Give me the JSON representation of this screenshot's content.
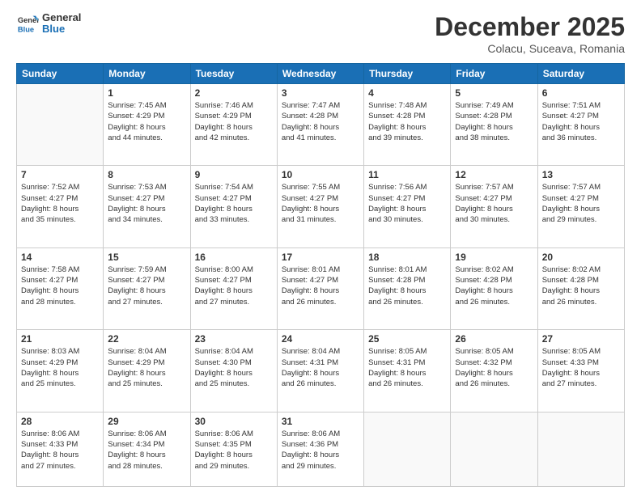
{
  "header": {
    "logo_line1": "General",
    "logo_line2": "Blue",
    "month_title": "December 2025",
    "location": "Colacu, Suceava, Romania"
  },
  "weekdays": [
    "Sunday",
    "Monday",
    "Tuesday",
    "Wednesday",
    "Thursday",
    "Friday",
    "Saturday"
  ],
  "weeks": [
    [
      {
        "day": "",
        "detail": ""
      },
      {
        "day": "1",
        "detail": "Sunrise: 7:45 AM\nSunset: 4:29 PM\nDaylight: 8 hours\nand 44 minutes."
      },
      {
        "day": "2",
        "detail": "Sunrise: 7:46 AM\nSunset: 4:29 PM\nDaylight: 8 hours\nand 42 minutes."
      },
      {
        "day": "3",
        "detail": "Sunrise: 7:47 AM\nSunset: 4:28 PM\nDaylight: 8 hours\nand 41 minutes."
      },
      {
        "day": "4",
        "detail": "Sunrise: 7:48 AM\nSunset: 4:28 PM\nDaylight: 8 hours\nand 39 minutes."
      },
      {
        "day": "5",
        "detail": "Sunrise: 7:49 AM\nSunset: 4:28 PM\nDaylight: 8 hours\nand 38 minutes."
      },
      {
        "day": "6",
        "detail": "Sunrise: 7:51 AM\nSunset: 4:27 PM\nDaylight: 8 hours\nand 36 minutes."
      }
    ],
    [
      {
        "day": "7",
        "detail": "Sunrise: 7:52 AM\nSunset: 4:27 PM\nDaylight: 8 hours\nand 35 minutes."
      },
      {
        "day": "8",
        "detail": "Sunrise: 7:53 AM\nSunset: 4:27 PM\nDaylight: 8 hours\nand 34 minutes."
      },
      {
        "day": "9",
        "detail": "Sunrise: 7:54 AM\nSunset: 4:27 PM\nDaylight: 8 hours\nand 33 minutes."
      },
      {
        "day": "10",
        "detail": "Sunrise: 7:55 AM\nSunset: 4:27 PM\nDaylight: 8 hours\nand 31 minutes."
      },
      {
        "day": "11",
        "detail": "Sunrise: 7:56 AM\nSunset: 4:27 PM\nDaylight: 8 hours\nand 30 minutes."
      },
      {
        "day": "12",
        "detail": "Sunrise: 7:57 AM\nSunset: 4:27 PM\nDaylight: 8 hours\nand 30 minutes."
      },
      {
        "day": "13",
        "detail": "Sunrise: 7:57 AM\nSunset: 4:27 PM\nDaylight: 8 hours\nand 29 minutes."
      }
    ],
    [
      {
        "day": "14",
        "detail": "Sunrise: 7:58 AM\nSunset: 4:27 PM\nDaylight: 8 hours\nand 28 minutes."
      },
      {
        "day": "15",
        "detail": "Sunrise: 7:59 AM\nSunset: 4:27 PM\nDaylight: 8 hours\nand 27 minutes."
      },
      {
        "day": "16",
        "detail": "Sunrise: 8:00 AM\nSunset: 4:27 PM\nDaylight: 8 hours\nand 27 minutes."
      },
      {
        "day": "17",
        "detail": "Sunrise: 8:01 AM\nSunset: 4:27 PM\nDaylight: 8 hours\nand 26 minutes."
      },
      {
        "day": "18",
        "detail": "Sunrise: 8:01 AM\nSunset: 4:28 PM\nDaylight: 8 hours\nand 26 minutes."
      },
      {
        "day": "19",
        "detail": "Sunrise: 8:02 AM\nSunset: 4:28 PM\nDaylight: 8 hours\nand 26 minutes."
      },
      {
        "day": "20",
        "detail": "Sunrise: 8:02 AM\nSunset: 4:28 PM\nDaylight: 8 hours\nand 26 minutes."
      }
    ],
    [
      {
        "day": "21",
        "detail": "Sunrise: 8:03 AM\nSunset: 4:29 PM\nDaylight: 8 hours\nand 25 minutes."
      },
      {
        "day": "22",
        "detail": "Sunrise: 8:04 AM\nSunset: 4:29 PM\nDaylight: 8 hours\nand 25 minutes."
      },
      {
        "day": "23",
        "detail": "Sunrise: 8:04 AM\nSunset: 4:30 PM\nDaylight: 8 hours\nand 25 minutes."
      },
      {
        "day": "24",
        "detail": "Sunrise: 8:04 AM\nSunset: 4:31 PM\nDaylight: 8 hours\nand 26 minutes."
      },
      {
        "day": "25",
        "detail": "Sunrise: 8:05 AM\nSunset: 4:31 PM\nDaylight: 8 hours\nand 26 minutes."
      },
      {
        "day": "26",
        "detail": "Sunrise: 8:05 AM\nSunset: 4:32 PM\nDaylight: 8 hours\nand 26 minutes."
      },
      {
        "day": "27",
        "detail": "Sunrise: 8:05 AM\nSunset: 4:33 PM\nDaylight: 8 hours\nand 27 minutes."
      }
    ],
    [
      {
        "day": "28",
        "detail": "Sunrise: 8:06 AM\nSunset: 4:33 PM\nDaylight: 8 hours\nand 27 minutes."
      },
      {
        "day": "29",
        "detail": "Sunrise: 8:06 AM\nSunset: 4:34 PM\nDaylight: 8 hours\nand 28 minutes."
      },
      {
        "day": "30",
        "detail": "Sunrise: 8:06 AM\nSunset: 4:35 PM\nDaylight: 8 hours\nand 29 minutes."
      },
      {
        "day": "31",
        "detail": "Sunrise: 8:06 AM\nSunset: 4:36 PM\nDaylight: 8 hours\nand 29 minutes."
      },
      {
        "day": "",
        "detail": ""
      },
      {
        "day": "",
        "detail": ""
      },
      {
        "day": "",
        "detail": ""
      }
    ]
  ]
}
